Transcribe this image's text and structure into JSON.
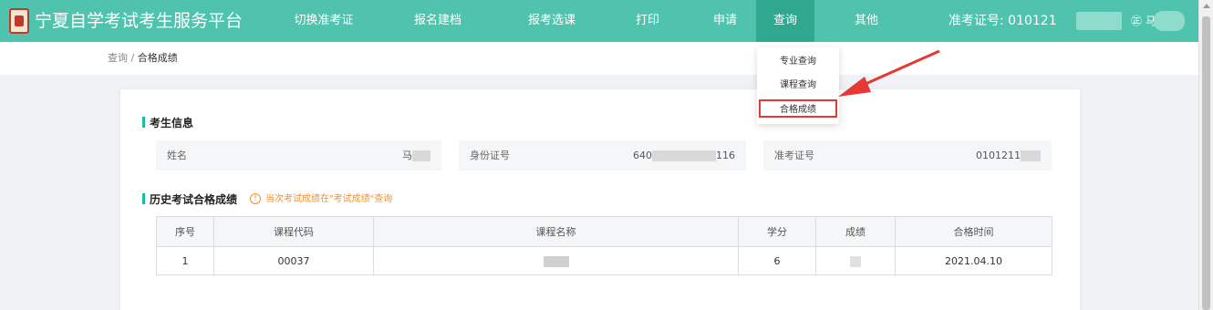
{
  "header": {
    "brand": "宁夏自学考试考生服务平台",
    "nav": [
      "切换准考证",
      "报名建档",
      "报考选课",
      "打印",
      "申请",
      "查询",
      "其他"
    ],
    "exam_no": "准考证号: 010121",
    "user": "㊣ 马"
  },
  "breadcrumb": {
    "parent": "查询",
    "sep": " / ",
    "current": "合格成绩"
  },
  "dropdown": {
    "items": [
      "专业查询",
      "课程查询",
      "合格成绩"
    ]
  },
  "student_info": {
    "title": "考生信息",
    "name_label": "姓名",
    "name_value": "马",
    "id_label": "身份证号",
    "id_prefix": "640",
    "id_suffix": "116",
    "exam_label": "准考证号",
    "exam_value": "0101211"
  },
  "history": {
    "title": "历史考试合格成绩",
    "tip": "当次考试成绩在\"考试成绩\"查询",
    "tip_icon": "!",
    "columns": [
      "序号",
      "课程代码",
      "课程名称",
      "学分",
      "成绩",
      "合格时间"
    ],
    "rows": [
      {
        "index": "1",
        "code": "00037",
        "name": "",
        "credit": "6",
        "score": "",
        "date": "2021.04.10"
      }
    ]
  },
  "colors": {
    "header": "#4fc3ad",
    "accent": "#1abc9c",
    "warning": "#f0912d",
    "highlight": "#e53935"
  }
}
